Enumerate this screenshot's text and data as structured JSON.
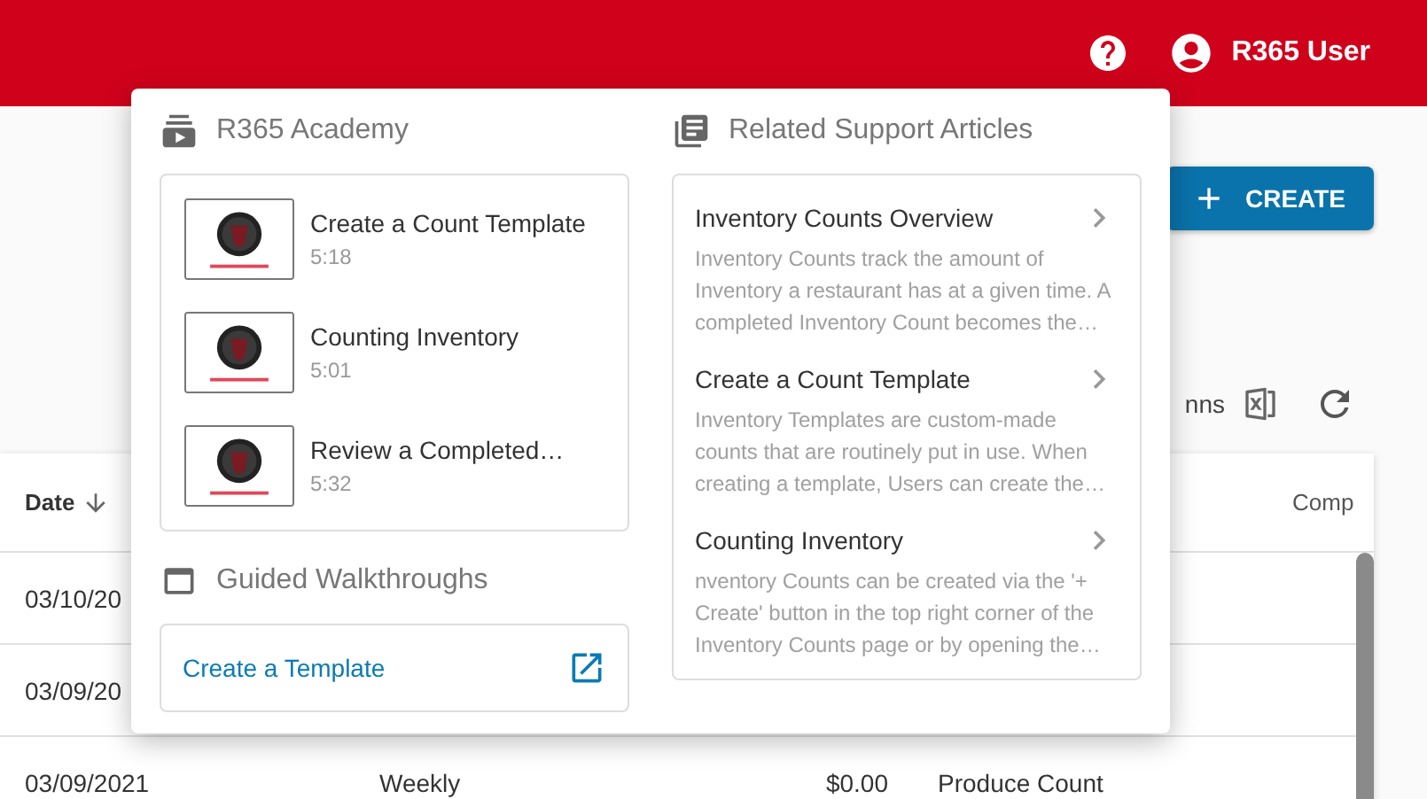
{
  "header": {
    "user_name": "R365 User"
  },
  "create_button": {
    "label": "CREATE"
  },
  "toolbar": {
    "columns_label": "nns"
  },
  "table": {
    "columns": [
      {
        "label": "Date",
        "sorted": true
      },
      {},
      {},
      {},
      {
        "label": "Comp"
      }
    ],
    "rows": [
      [
        "03/10/20"
      ],
      [
        "03/09/20"
      ],
      [
        "03/09/2021",
        "Weekly",
        "$0.00",
        "Produce Count"
      ]
    ]
  },
  "help_popover": {
    "academy": {
      "title": "R365 Academy",
      "videos": [
        {
          "title": "Create a Count Template",
          "duration": "5:18"
        },
        {
          "title": "Counting Inventory",
          "duration": "5:01"
        },
        {
          "title": "Review a Completed…",
          "duration": "5:32"
        }
      ]
    },
    "walkthroughs": {
      "title": "Guided Walkthroughs",
      "items": [
        {
          "label": "Create a Template"
        }
      ]
    },
    "articles": {
      "title": "Related Support Articles",
      "items": [
        {
          "title": "Inventory Counts Overview",
          "summary": "Inventory Counts track the amount of Inventory a restaurant has at a given time. A completed Inventory Count becomes the…"
        },
        {
          "title": "Create a Count Template",
          "summary": "Inventory Templates are custom-made counts that are routinely put in use. When creating a template, Users can create the…"
        },
        {
          "title": "Counting Inventory",
          "summary": "nventory Counts can be created via the '+ Create' button in the top right corner of the Inventory Counts page or by opening the…"
        }
      ]
    }
  }
}
